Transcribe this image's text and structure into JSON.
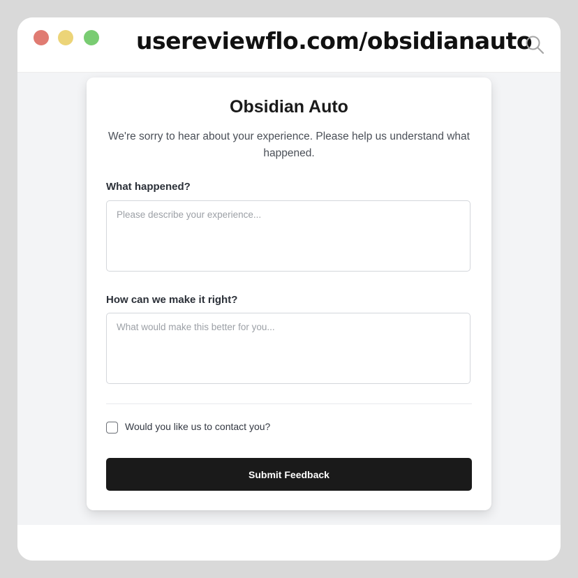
{
  "browser": {
    "url": "usereviewflo.com/obsidianauto",
    "search_icon": "search-icon"
  },
  "form": {
    "title": "Obsidian Auto",
    "subtitle": "We're sorry to hear about your experience. Please help us understand what happened.",
    "field1": {
      "label": "What happened?",
      "placeholder": "Please describe your experience...",
      "value": ""
    },
    "field2": {
      "label": "How can we make it right?",
      "placeholder": "What would make this better for you...",
      "value": ""
    },
    "contact": {
      "label": "Would you like us to contact you?",
      "checked": false
    },
    "submit_label": "Submit Feedback"
  },
  "colors": {
    "traffic_red": "#e07b72",
    "traffic_yellow": "#ecd478",
    "traffic_green": "#79cc72",
    "button_bg": "#1a1a1a",
    "page_bg": "#f3f4f6"
  }
}
